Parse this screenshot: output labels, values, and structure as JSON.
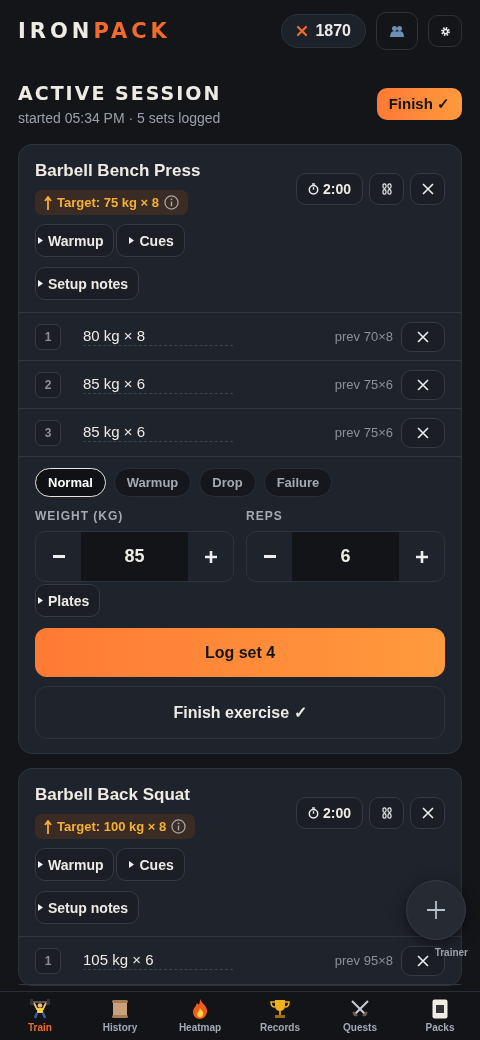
{
  "header": {
    "logo_parts": [
      "IRON",
      "PACK"
    ],
    "points": "1870"
  },
  "session": {
    "title": "ACTIVE SESSION",
    "subtitle": "started 05:34 PM · 5 sets logged",
    "finish_button": "Finish ✓"
  },
  "exercises": [
    {
      "name": "Barbell Bench Press",
      "target": "Target: 75 kg × 8",
      "timer": "2:00",
      "toggles": [
        "Warmup",
        "Cues",
        "Setup notes"
      ],
      "sets": [
        {
          "index": "1",
          "value": "80 kg × 8",
          "prev": "prev 70×8"
        },
        {
          "index": "2",
          "value": "85 kg × 6",
          "prev": "prev 75×6"
        },
        {
          "index": "3",
          "value": "85 kg × 6",
          "prev": "prev 75×6"
        }
      ],
      "entry": {
        "set_types": [
          {
            "label": "Normal",
            "selected": true
          },
          {
            "label": "Warmup",
            "selected": false
          },
          {
            "label": "Drop",
            "selected": false
          },
          {
            "label": "Failure",
            "selected": false
          }
        ],
        "weight_label": "WEIGHT (KG)",
        "weight_value": "85",
        "reps_label": "REPS",
        "reps_value": "6",
        "plates": "Plates",
        "log_button": "Log set 4",
        "finish_button": "Finish exercise ✓"
      }
    },
    {
      "name": "Barbell Back Squat",
      "target": "Target: 100 kg × 8",
      "timer": "2:00",
      "toggles": [
        "Warmup",
        "Cues",
        "Setup notes"
      ],
      "sets": [
        {
          "index": "1",
          "value": "105 kg × 6",
          "prev": "prev 95×8"
        }
      ]
    }
  ],
  "fab": {
    "label": "Trainer"
  },
  "nav": [
    {
      "label": "Train",
      "selected": true,
      "kind": "lifter"
    },
    {
      "label": "History",
      "selected": false,
      "kind": "scroll"
    },
    {
      "label": "Heatmap",
      "selected": false,
      "kind": "fire"
    },
    {
      "label": "Records",
      "selected": false,
      "kind": "trophy"
    },
    {
      "label": "Quests",
      "selected": false,
      "kind": "swords"
    },
    {
      "label": "Packs",
      "selected": false,
      "kind": "card"
    }
  ]
}
